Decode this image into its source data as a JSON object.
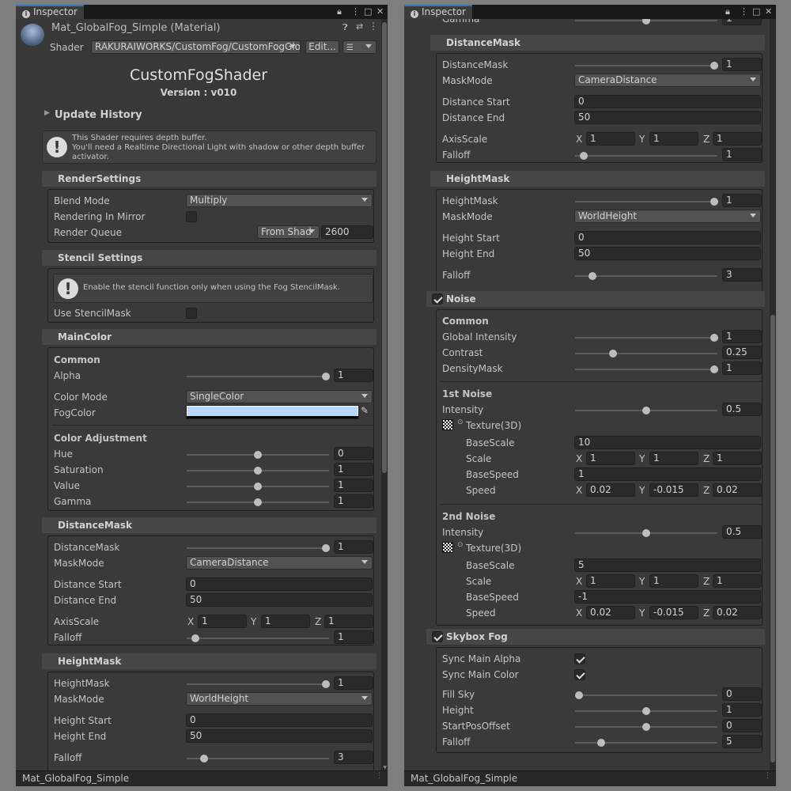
{
  "tab_title": "Inspector",
  "left": {
    "material_name": "Mat_GlobalFog_Simple (Material)",
    "shader_label": "Shader",
    "shader_value": "RAKURAIWORKS/CustomFog/CustomFogGlo",
    "edit_label": "Edit...",
    "shader_title": "CustomFogShader",
    "version": "Version : v010",
    "update_history": "Update History",
    "help_depth": "This Shader requires depth buffer.\nYou'll need a Realtime Directional Light with shadow or other depth buffer activator.",
    "render_settings": {
      "title": "RenderSettings",
      "blend_mode_label": "Blend Mode",
      "blend_mode": "Multiply",
      "mirror_label": "Rendering In Mirror",
      "queue_label": "Render Queue",
      "queue_mode": "From Shad",
      "queue_value": "2600"
    },
    "stencil": {
      "title": "Stencil Settings",
      "help": "Enable the stencil function only when using the Fog StencilMask.",
      "use_label": "Use StencilMask"
    },
    "main_color": {
      "title": "MainColor",
      "common": "Common",
      "alpha_label": "Alpha",
      "alpha": "1",
      "color_mode_label": "Color Mode",
      "color_mode": "SingleColor",
      "fog_color_label": "FogColor",
      "fog_color": "#b9d6ff",
      "adjust": "Color Adjustment",
      "hue_label": "Hue",
      "hue": "0",
      "saturation_label": "Saturation",
      "saturation": "1",
      "value_label": "Value",
      "value": "1",
      "gamma_label": "Gamma",
      "gamma": "1"
    },
    "distance_mask": {
      "title": "DistanceMask",
      "mask_label": "DistanceMask",
      "mask": "1",
      "mode_label": "MaskMode",
      "mode": "CameraDistance",
      "start_label": "Distance Start",
      "start": "0",
      "end_label": "Distance End",
      "end": "50",
      "axis_label": "AxisScale",
      "ax": "1",
      "ay": "1",
      "az": "1",
      "falloff_label": "Falloff",
      "falloff": "1"
    },
    "height_mask": {
      "title": "HeightMask",
      "mask_label": "HeightMask",
      "mask": "1",
      "mode_label": "MaskMode",
      "mode": "WorldHeight",
      "start_label": "Height Start",
      "start": "0",
      "end_label": "Height End",
      "end": "50",
      "falloff_label": "Falloff",
      "falloff": "3"
    },
    "footer": "Mat_GlobalFog_Simple"
  },
  "right": {
    "gamma_partial": "Gamma",
    "gamma_partial_value": "1",
    "distance_mask": {
      "title": "DistanceMask",
      "mask_label": "DistanceMask",
      "mask": "1",
      "mode_label": "MaskMode",
      "mode": "CameraDistance",
      "start_label": "Distance Start",
      "start": "0",
      "end_label": "Distance End",
      "end": "50",
      "axis_label": "AxisScale",
      "ax": "1",
      "ay": "1",
      "az": "1",
      "falloff_label": "Falloff",
      "falloff": "1"
    },
    "height_mask": {
      "title": "HeightMask",
      "mask_label": "HeightMask",
      "mask": "1",
      "mode_label": "MaskMode",
      "mode": "WorldHeight",
      "start_label": "Height Start",
      "start": "0",
      "end_label": "Height End",
      "end": "50",
      "falloff_label": "Falloff",
      "falloff": "3"
    },
    "noise": {
      "title": "Noise",
      "common": "Common",
      "global_label": "Global Intensity",
      "global": "1",
      "contrast_label": "Contrast",
      "contrast": "0.25",
      "density_label": "DensityMask",
      "density": "1",
      "n1_title": "1st Noise",
      "n1_intensity_label": "Intensity",
      "n1_intensity": "0.5",
      "n1_tex": "Texture(3D)",
      "n1_basescale_label": "BaseScale",
      "n1_basescale": "10",
      "n1_scale_label": "Scale",
      "n1_sx": "1",
      "n1_sy": "1",
      "n1_sz": "1",
      "n1_basespeed_label": "BaseSpeed",
      "n1_basespeed": "1",
      "n1_speed_label": "Speed",
      "n1_vx": "0.02",
      "n1_vy": "-0.015",
      "n1_vz": "0.02",
      "n2_title": "2nd Noise",
      "n2_intensity_label": "Intensity",
      "n2_intensity": "0.5",
      "n2_tex": "Texture(3D)",
      "n2_basescale_label": "BaseScale",
      "n2_basescale": "5",
      "n2_scale_label": "Scale",
      "n2_sx": "1",
      "n2_sy": "1",
      "n2_sz": "1",
      "n2_basespeed_label": "BaseSpeed",
      "n2_basespeed": "-1",
      "n2_speed_label": "Speed",
      "n2_vx": "0.02",
      "n2_vy": "-0.015",
      "n2_vz": "0.02"
    },
    "skybox": {
      "title": "Skybox Fog",
      "alpha_label": "Sync Main Alpha",
      "color_label": "Sync Main Color",
      "fill_label": "Fill Sky",
      "fill": "0",
      "height_label": "Height",
      "height": "1",
      "offset_label": "StartPosOffset",
      "offset": "0",
      "falloff_label": "Falloff",
      "falloff": "5"
    },
    "footer": "Mat_GlobalFog_Simple"
  },
  "axis": {
    "x": "X",
    "y": "Y",
    "z": "Z"
  }
}
